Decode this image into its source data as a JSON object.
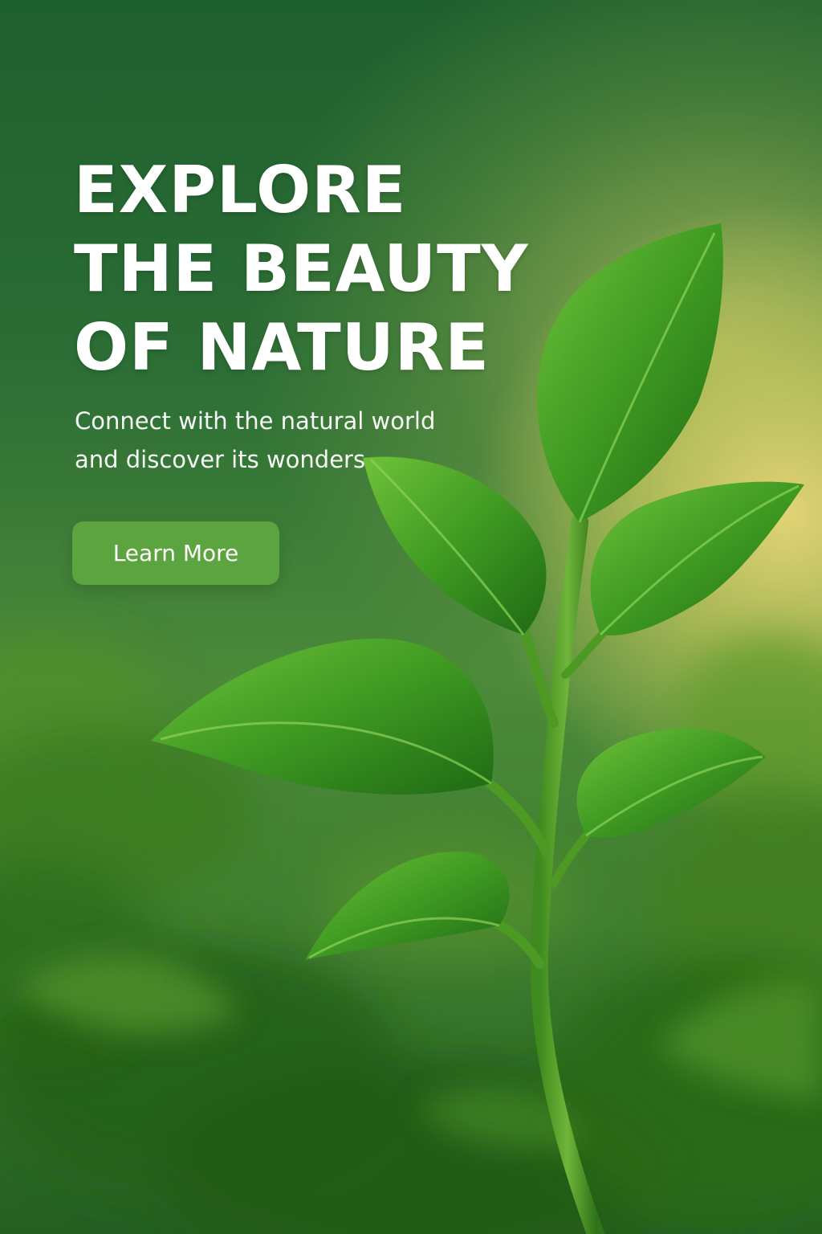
{
  "hero": {
    "headline": [
      "EXPLORE",
      "THE BEAUTY",
      "OF NATURE"
    ],
    "subtitle": [
      "Connect with the natural world",
      "and discover its wonders"
    ],
    "cta_label": "Learn More"
  },
  "colors": {
    "text": "#ffffff",
    "button": "#5ca43f",
    "leaf": "#3f9a24",
    "background_dark": "#1e5f2e",
    "background_glow": "#e8d678"
  }
}
